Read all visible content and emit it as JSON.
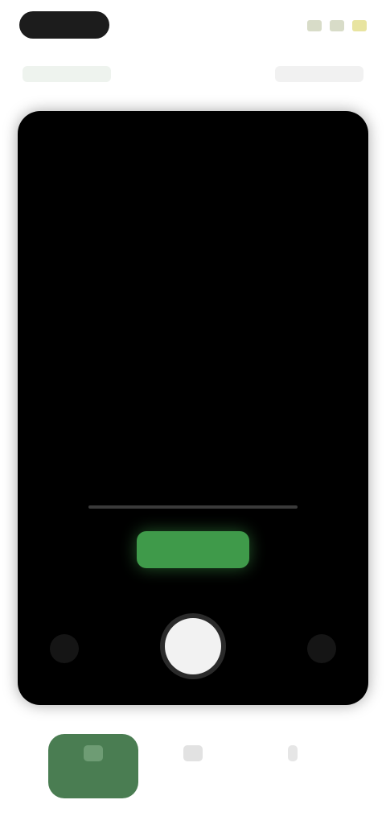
{
  "status_bar": {
    "colors": {
      "pill": "#1c1c1c",
      "icons": "#d8dcc8"
    }
  },
  "top_bar": {
    "left_text": "",
    "right_text": ""
  },
  "camera": {
    "hint_text": "",
    "action_label": "",
    "accent_color": "#3f9a4a"
  },
  "nav": {
    "items": [
      {
        "label": "",
        "icon": "camera-icon",
        "active": true
      },
      {
        "label": "",
        "icon": "grid-icon",
        "active": false
      },
      {
        "label": "",
        "icon": "person-icon",
        "active": false
      }
    ],
    "active_color": "#4a7d52"
  }
}
